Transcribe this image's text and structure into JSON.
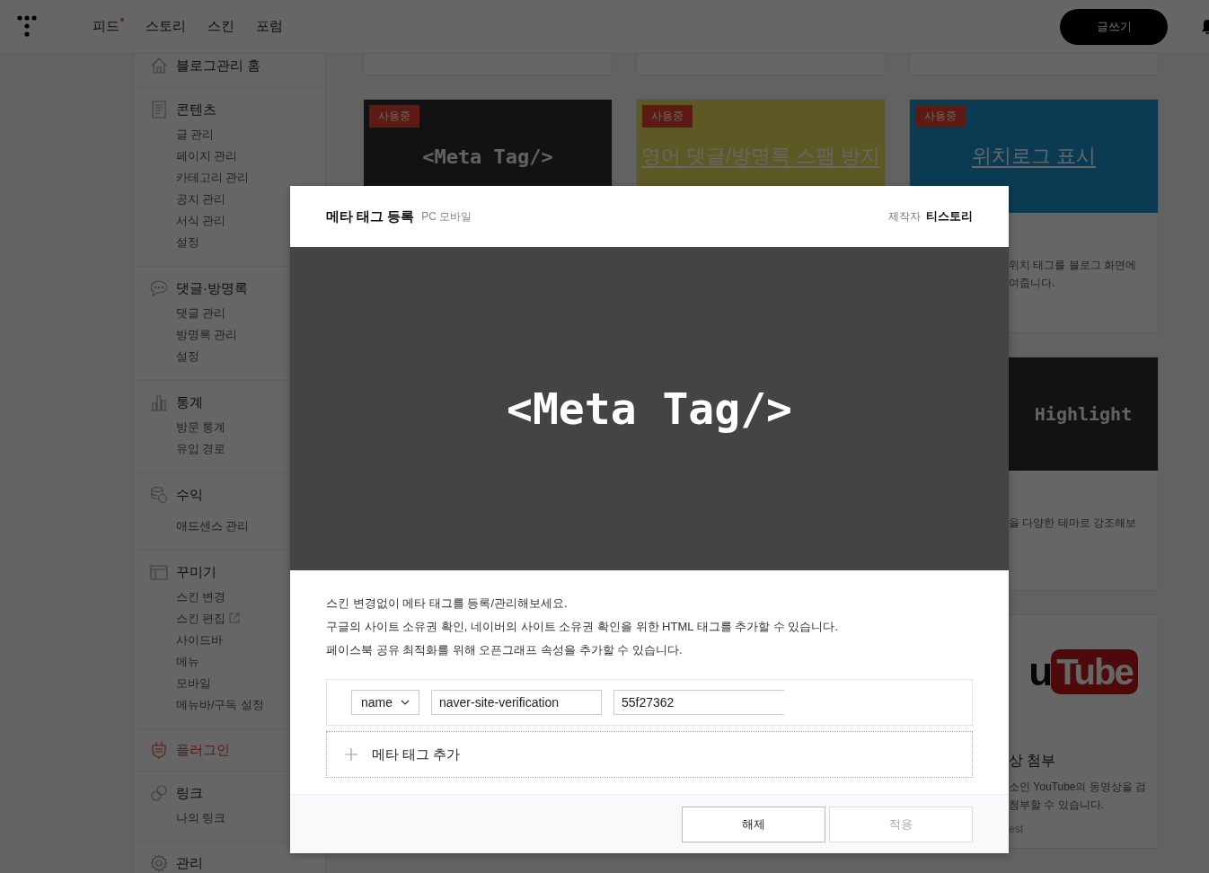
{
  "header": {
    "nav": [
      {
        "label": "피드",
        "new": true
      },
      {
        "label": "스토리",
        "new": false
      },
      {
        "label": "스킨",
        "new": false
      },
      {
        "label": "포럼",
        "new": false
      }
    ],
    "write_button": "글쓰기"
  },
  "sidebar": [
    {
      "title": "블로그관리 홈",
      "selected": false
    },
    {
      "title": "콘텐츠",
      "selected": false,
      "items": [
        {
          "label": "글 관리",
          "external": false
        },
        {
          "label": "페이지 관리",
          "external": false
        },
        {
          "label": "카테고리 관리",
          "external": false
        },
        {
          "label": "공지 관리",
          "external": false
        },
        {
          "label": "서식 관리",
          "external": false
        },
        {
          "label": "설정",
          "external": false
        }
      ]
    },
    {
      "title": "댓글·방명록",
      "selected": false,
      "items": [
        {
          "label": "댓글 관리",
          "external": false
        },
        {
          "label": "방명록 관리",
          "external": false
        },
        {
          "label": "설정",
          "external": false
        }
      ]
    },
    {
      "title": "통계",
      "selected": false,
      "items": [
        {
          "label": "방문 통계",
          "external": false
        },
        {
          "label": "유입 경로",
          "external": false
        }
      ]
    },
    {
      "title": "수익",
      "selected": false,
      "items": [
        {
          "label": "애드센스 관리",
          "external": false
        }
      ]
    },
    {
      "title": "꾸미기",
      "selected": false,
      "items": [
        {
          "label": "스킨 변경",
          "external": false
        },
        {
          "label": "스킨 편집",
          "external": true
        },
        {
          "label": "사이드바",
          "external": false
        },
        {
          "label": "메뉴",
          "external": false
        },
        {
          "label": "모바일",
          "external": false
        },
        {
          "label": "메뉴바/구독 설정",
          "external": false
        }
      ]
    },
    {
      "title": "플러그인",
      "selected": true
    },
    {
      "title": "링크",
      "selected": false,
      "items": [
        {
          "label": "나의 링크",
          "external": false
        }
      ]
    },
    {
      "title": "관리",
      "selected": false
    }
  ],
  "plugin_cards": [
    {
      "kind": "code",
      "badge": "사용중",
      "title": "<Meta Tag/>"
    },
    {
      "kind": "yellow",
      "badge": "사용중",
      "title": "영어 댓글/방명록 스팸 방지"
    },
    {
      "kind": "blue",
      "badge": "사용중",
      "title": "위치로그 표시",
      "description": [
        "위치 태그를 블로그 화면에",
        "여줍니다."
      ]
    },
    {
      "kind": "code",
      "title": "Highlight",
      "description": [
        "을 다양한 테마로 강조해보"
      ]
    },
    {
      "kind": "youtube",
      "logo_left": "u",
      "logo_right": "Tube",
      "name": "상 첨부",
      "description": [
        "소인 YouTube의 동영상을 검",
        "첨부할 수 있습니다."
      ],
      "author": "est"
    }
  ],
  "modal": {
    "title": "메타 태그 등록",
    "platforms": "PC 모바일",
    "author_label": "제작자",
    "author": "티스토리",
    "preview": "<Meta Tag/>",
    "description": [
      "스킨 변경없이 메타 태그를 등록/관리해보세요.",
      "구글의 사이트 소유권 확인, 네이버의 사이트 소유권 확인을 위한 HTML 태그를 추가할 수 있습니다.",
      "페이스북 공유 최적화를 위해 오픈그래프 속성을 추가할 수 있습니다."
    ],
    "tag_row": {
      "attribute": "name",
      "key": "naver-site-verification",
      "value": "55f27362"
    },
    "add_label": "메타 태그 추가",
    "buttons": [
      {
        "label": "해제",
        "disabled": false
      },
      {
        "label": "적용",
        "disabled": true
      }
    ]
  }
}
